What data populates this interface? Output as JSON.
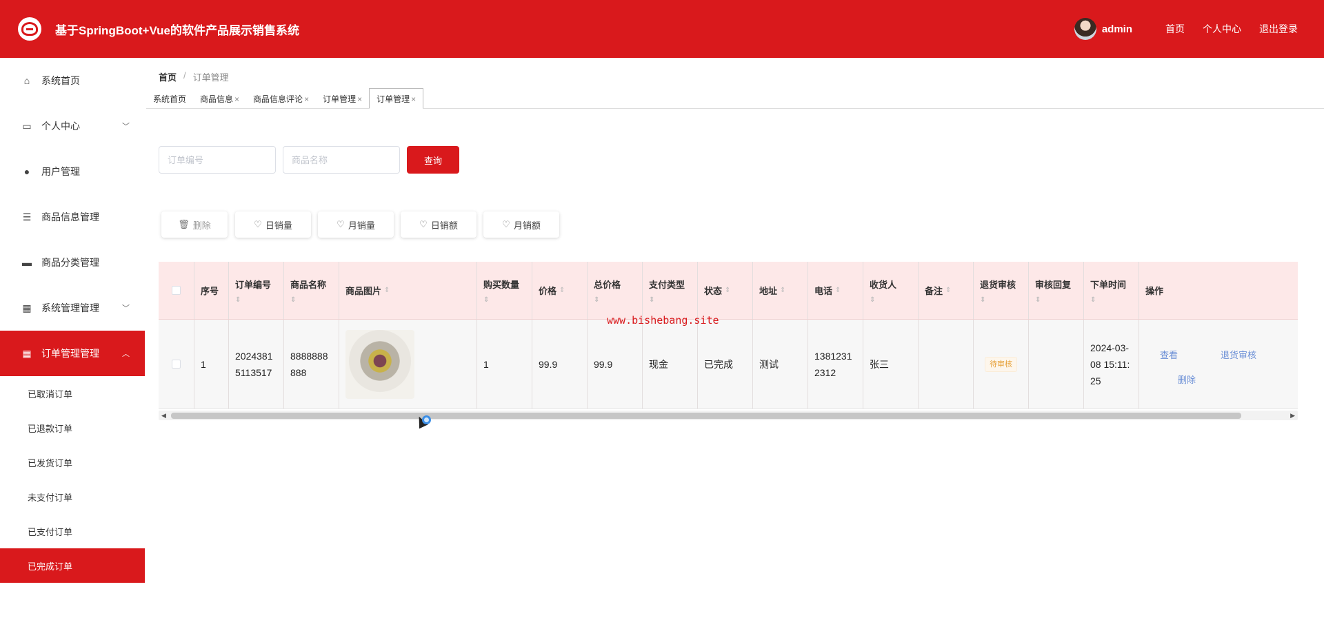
{
  "header": {
    "title": "基于SpringBoot+Vue的软件产品展示销售系统",
    "username": "admin",
    "links": [
      "首页",
      "个人中心",
      "退出登录"
    ]
  },
  "sidebar": {
    "items": [
      {
        "label": "系统首页",
        "icon": "home-icon"
      },
      {
        "label": "个人中心",
        "icon": "wallet-icon"
      },
      {
        "label": "用户管理",
        "icon": "user-icon"
      },
      {
        "label": "商品信息管理",
        "icon": "list-icon"
      },
      {
        "label": "商品分类管理",
        "icon": "monitor-icon"
      },
      {
        "label": "系统管理管理",
        "icon": "grid-icon"
      },
      {
        "label": "订单管理管理",
        "icon": "grid-icon"
      }
    ],
    "sub_items": [
      "已取消订单",
      "已退款订单",
      "已发货订单",
      "未支付订单",
      "已支付订单",
      "已完成订单"
    ]
  },
  "breadcrumb": {
    "home": "首页",
    "sep": "/",
    "current": "订单管理"
  },
  "tabs": [
    "系统首页",
    "商品信息",
    "商品信息评论",
    "订单管理",
    "订单管理"
  ],
  "search": {
    "order_no_placeholder": "订单编号",
    "product_name_placeholder": "商品名称",
    "query_label": "查询"
  },
  "actions": {
    "delete": "删除",
    "daily_sales_qty": "日销量",
    "monthly_sales_qty": "月销量",
    "daily_sales_amt": "日销额",
    "monthly_sales_amt": "月销额"
  },
  "table": {
    "headers": {
      "index": "序号",
      "order_no": "订单编号",
      "product_name": "商品名称",
      "product_image": "商品图片",
      "quantity": "购买数量",
      "price": "价格",
      "total": "总价格",
      "pay_type": "支付类型",
      "status": "状态",
      "address": "地址",
      "phone": "电话",
      "receiver": "收货人",
      "remark": "备注",
      "return_review": "退货审核",
      "review_reply": "审核回复",
      "order_time": "下单时间",
      "operation": "操作"
    },
    "rows": [
      {
        "index": "1",
        "order_no": "20243815113517",
        "product_name": "8888888888",
        "quantity": "1",
        "price": "99.9",
        "total": "99.9",
        "pay_type": "现金",
        "status": "已完成",
        "address": "测试",
        "phone": "13812312312",
        "receiver": "张三",
        "remark": "",
        "return_review": "待审核",
        "review_reply": "",
        "order_time": "2024-03-08 15:11:25",
        "ops": {
          "view": "查看",
          "return_audit": "退货审核",
          "delete": "删除"
        }
      }
    ]
  },
  "watermark": "www.bishebang.site"
}
